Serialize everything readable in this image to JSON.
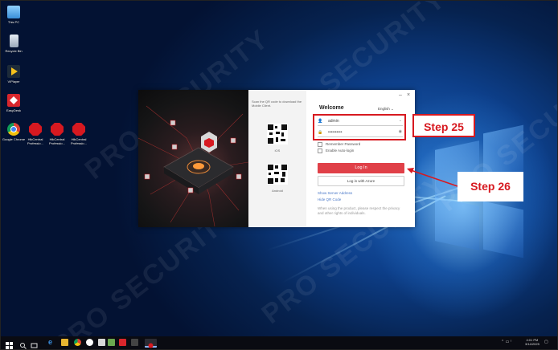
{
  "desktop": {
    "watermark": "PRO SECURITY",
    "icons": [
      {
        "label": "This PC",
        "icon": "computer-icon",
        "color": "#6fb3e8"
      },
      {
        "label": "Recycle Bin",
        "icon": "recycle-bin-icon",
        "color": "#cfd8e3"
      },
      {
        "label": "VIPlayer",
        "icon": "play-icon",
        "color": "#1d2b3a"
      },
      {
        "label": "EasyDesk",
        "icon": "easydesk-icon",
        "color": "#d9262c"
      },
      {
        "label": "Google Chrome",
        "icon": "chrome-icon",
        "color": "#f4c20d"
      },
      {
        "label": "HikCentral Professio...",
        "icon": "hikcentral-icon",
        "color": "#d71920"
      },
      {
        "label": "HikCentral Professio...",
        "icon": "hikcentral-icon",
        "color": "#d71920"
      },
      {
        "label": "HikCentral Professio...",
        "icon": "hikcentral-icon",
        "color": "#d71920"
      }
    ]
  },
  "login": {
    "qr_hint": "Scan the QR code to download the Mobile Client.",
    "ios_label": "iOS",
    "android_label": "Android",
    "minimize": "–",
    "close": "×",
    "welcome": "Welcome",
    "language": "English",
    "username": "admin",
    "password": "••••••••••",
    "remember": "Remember Password",
    "auto_login": "Enable Auto-login",
    "login_button": "Log In",
    "azure_button": "Log in with Azure",
    "show_server": "Show Server Address",
    "hide_qr": "Hide QR Code",
    "privacy_note": "When using the product, please respect the privacy and other rights of individuals."
  },
  "callouts": {
    "step25": "Step 25",
    "step26": "Step 26"
  },
  "colors": {
    "accent": "#d71920",
    "login_button": "#e04048"
  },
  "taskbar": {
    "time": "4:01 PM",
    "date": "3/14/2025"
  }
}
